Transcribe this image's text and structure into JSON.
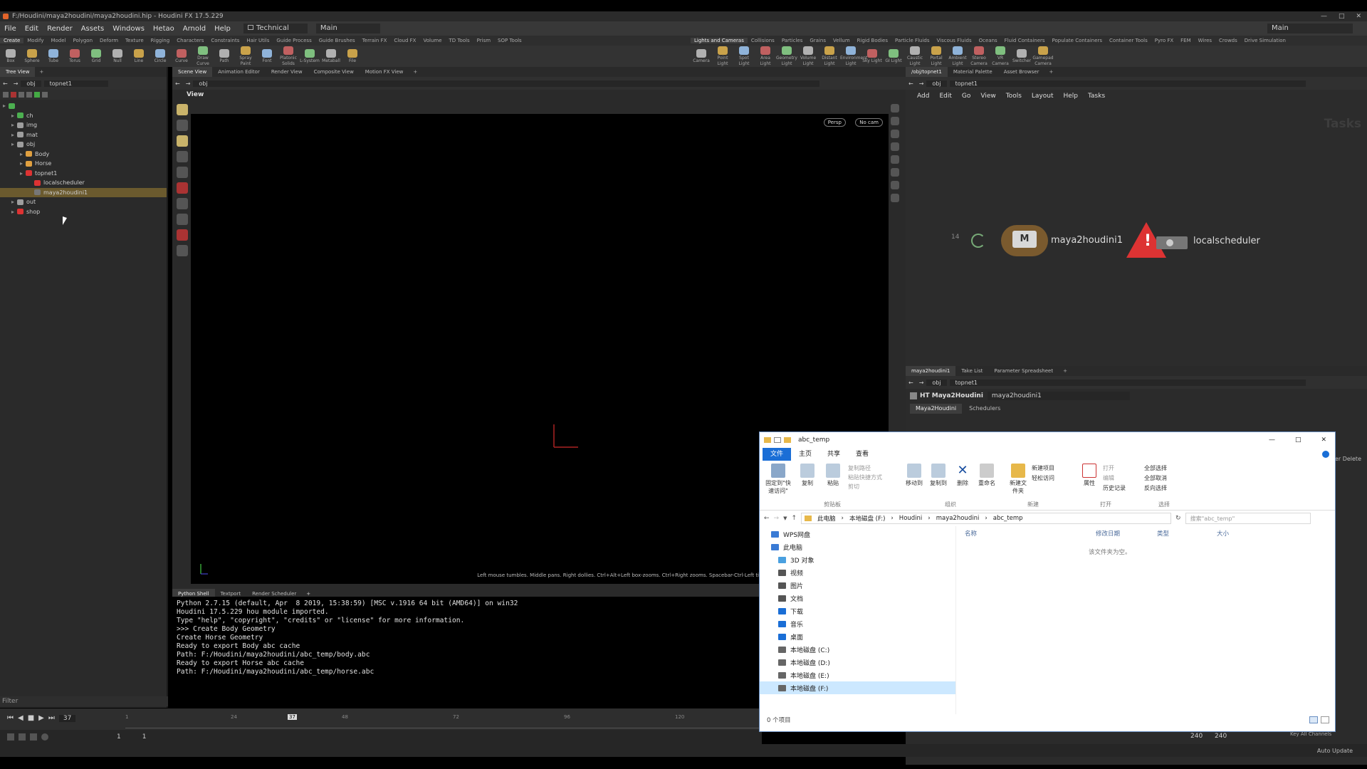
{
  "titlebar": {
    "title": "F:/Houdini/maya2houdini/maya2houdini.hip - Houdini FX 17.5.229"
  },
  "menubar": {
    "items": [
      "File",
      "Edit",
      "Render",
      "Assets",
      "Windows",
      "Hetao",
      "Arnold",
      "Help"
    ],
    "desktop_label": "Technical",
    "main_label": "Main",
    "right_label": "Main"
  },
  "shelf_tabs_left": [
    "Create",
    "Modify",
    "Model",
    "Polygon",
    "Deform",
    "Texture",
    "Rigging",
    "Characters",
    "Constraints",
    "Hair Utils",
    "Guide Process",
    "Guide Brushes",
    "Terrain FX",
    "Cloud FX",
    "Volume",
    "TD Tools",
    "Prism",
    "SOP Tools"
  ],
  "shelf_tabs_right": [
    "Lights and Cameras",
    "Collisions",
    "Particles",
    "Grains",
    "Vellum",
    "Rigid Bodies",
    "Particle Fluids",
    "Viscous Fluids",
    "Oceans",
    "Fluid Containers",
    "Populate Containers",
    "Container Tools",
    "Pyro FX",
    "FEM",
    "Wires",
    "Crowds",
    "Drive Simulation"
  ],
  "shelf_tools_left": [
    "Box",
    "Sphere",
    "Tube",
    "Torus",
    "Grid",
    "Null",
    "Line",
    "Circle",
    "Curve",
    "Draw Curve",
    "Path",
    "Spray Paint",
    "Font",
    "Platonic Solids",
    "L-System",
    "Metaball",
    "File"
  ],
  "shelf_tools_right": [
    "Camera",
    "Point Light",
    "Spot Light",
    "Area Light",
    "Geometry Light",
    "Volume Light",
    "Distant Light",
    "Environment Light",
    "Sky Light",
    "GI Light",
    "Caustic Light",
    "Portal Light",
    "Ambient Light",
    "Stereo Camera",
    "VR Camera",
    "Switcher",
    "Gamepad Camera"
  ],
  "tree": {
    "header": "Tree View",
    "path": "obj",
    "network": "topnet1",
    "nodes": [
      {
        "label": "",
        "depth": 0,
        "color": "#4caf50"
      },
      {
        "label": "ch",
        "depth": 1,
        "color": "#4caf50"
      },
      {
        "label": "img",
        "depth": 1,
        "color": "#9e9e9e"
      },
      {
        "label": "mat",
        "depth": 1,
        "color": "#9e9e9e"
      },
      {
        "label": "obj",
        "depth": 1,
        "color": "#9e9e9e"
      },
      {
        "label": "Body",
        "depth": 2,
        "color": "#e0a040"
      },
      {
        "label": "Horse",
        "depth": 2,
        "color": "#e0a040"
      },
      {
        "label": "topnet1",
        "depth": 2,
        "color": "#d33"
      },
      {
        "label": "localscheduler",
        "depth": 3,
        "color": "#d33"
      },
      {
        "label": "maya2houdini1",
        "depth": 3,
        "color": "#777",
        "selected": true
      },
      {
        "label": "out",
        "depth": 1,
        "color": "#9e9e9e"
      },
      {
        "label": "shop",
        "depth": 1,
        "color": "#d33"
      }
    ],
    "filter_label": "Filter"
  },
  "viewport": {
    "tabs": [
      "Scene View",
      "Animation Editor",
      "Render View",
      "Composite View",
      "Motion FX View"
    ],
    "path": "obj",
    "view_label": "View",
    "persp": "Persp",
    "cam": "No cam",
    "hint": "Left mouse tumbles. Middle pans. Right dollies. Ctrl+Alt+Left box-zooms. Ctrl+Right zooms. Spacebar-Ctrl-Left tilts. Hold L for alternate tumble, dolly, and zoom."
  },
  "network": {
    "tabs": [
      "/obj/topnet1",
      "Material Palette",
      "Asset Browser"
    ],
    "path": "obj",
    "network": "topnet1",
    "menu": [
      "Add",
      "Edit",
      "Go",
      "View",
      "Tools",
      "Layout",
      "Help",
      "Tasks"
    ],
    "watermark": "Tasks",
    "counter": "14",
    "node1": "maya2houdini1",
    "node2": "localscheduler"
  },
  "params": {
    "tabs": [
      "maya2houdini1",
      "Take List",
      "Parameter Spreadsheet"
    ],
    "path": "obj",
    "network": "topnet1",
    "type_label": "HT Maya2Houdini",
    "node_name": "maya2houdini1",
    "subtabs": [
      "Maya2Houdini",
      "Schedulers"
    ],
    "side_label": "ter Delete"
  },
  "shell": {
    "tabs": [
      "Python Shell",
      "Textport",
      "Render Scheduler"
    ],
    "lines": [
      "Python 2.7.15 (default, Apr  8 2019, 15:38:59) [MSC v.1916 64 bit (AMD64)] on win32",
      "Houdini 17.5.229 hou module imported.",
      "Type \"help\", \"copyright\", \"credits\" or \"license\" for more information.",
      ">>> Create Body Geometry",
      "Create Horse Geometry",
      "Ready to export Body abc cache",
      "Path: F:/Houdini/maya2houdini/abc_temp/body.abc",
      "Ready to export Horse abc cache",
      "Path: F:/Houdini/maya2houdini/abc_temp/horse.abc"
    ]
  },
  "timeline": {
    "frame": "37",
    "marker": "37",
    "ticks": [
      "1",
      "24",
      "48",
      "72",
      "96",
      "120"
    ],
    "start": "1",
    "start2": "1",
    "end": "240",
    "end2": "240",
    "keys_label": "Key All Channels",
    "auto_update": "Auto Update"
  },
  "explorer": {
    "title": "abc_temp",
    "ribbon_tabs": [
      "文件",
      "主页",
      "共享",
      "查看"
    ],
    "groups": [
      "剪贴板",
      "组织",
      "新建",
      "打开",
      "选择"
    ],
    "buttons": {
      "pin": "固定到\"快速访问\"",
      "copy": "复制",
      "paste": "粘贴",
      "copy_path": "复制路径",
      "paste_shortcut": "粘贴快捷方式",
      "cut": "剪切",
      "move_to": "移动到",
      "copy_to": "复制到",
      "delete": "删除",
      "rename": "重命名",
      "new_folder": "新建文件夹",
      "new_item": "新建项目",
      "easy_access": "轻松访问",
      "properties": "属性",
      "open": "打开",
      "edit": "编辑",
      "history": "历史记录",
      "select_all": "全部选择",
      "select_none": "全部取消",
      "invert": "反向选择"
    },
    "breadcrumb": [
      "此电脑",
      "本地磁盘 (F:)",
      "Houdini",
      "maya2houdini",
      "abc_temp"
    ],
    "search_placeholder": "搜索\"abc_temp\"",
    "nav": [
      {
        "label": "WPS网盘",
        "color": "#3a7bd5"
      },
      {
        "label": "此电脑",
        "color": "#3a7bd5"
      },
      {
        "label": "3D 对象",
        "color": "#4aa0e0"
      },
      {
        "label": "视频",
        "color": "#555"
      },
      {
        "label": "图片",
        "color": "#555"
      },
      {
        "label": "文档",
        "color": "#555"
      },
      {
        "label": "下载",
        "color": "#1a6ed6"
      },
      {
        "label": "音乐",
        "color": "#1a6ed6"
      },
      {
        "label": "桌面",
        "color": "#1a6ed6"
      },
      {
        "label": "本地磁盘 (C:)",
        "color": "#666"
      },
      {
        "label": "本地磁盘 (D:)",
        "color": "#666"
      },
      {
        "label": "本地磁盘 (E:)",
        "color": "#666"
      },
      {
        "label": "本地磁盘 (F:)",
        "color": "#666"
      }
    ],
    "columns": [
      "名称",
      "修改日期",
      "类型",
      "大小"
    ],
    "empty": "该文件夹为空。",
    "status": "0 个项目"
  }
}
